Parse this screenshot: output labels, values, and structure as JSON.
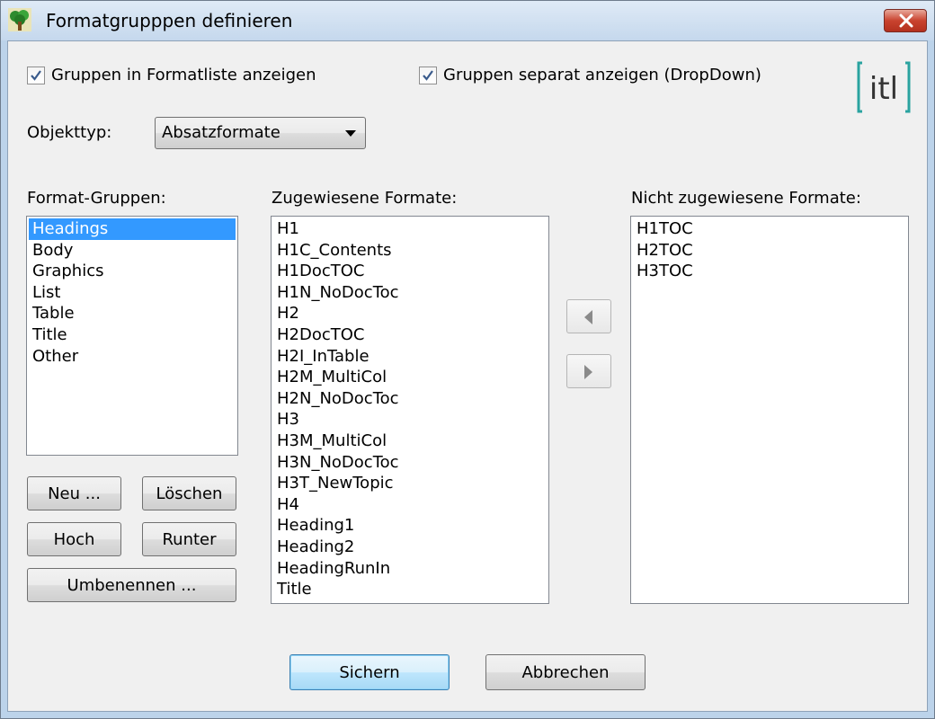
{
  "window": {
    "title": "Formatgrupppen definieren"
  },
  "options": {
    "show_groups_in_list": {
      "label": "Gruppen in Formatliste anzeigen",
      "checked": true
    },
    "show_groups_separately": {
      "label": "Gruppen separat anzeigen (DropDown)",
      "checked": true
    }
  },
  "logo": {
    "text": "itl",
    "color": "#2aa3a0"
  },
  "object_type": {
    "label": "Objekttyp:",
    "value": "Absatzformate"
  },
  "format_groups": {
    "label": "Format-Gruppen:",
    "items": [
      "Headings",
      "Body",
      "Graphics",
      "List",
      "Table",
      "Title",
      "Other"
    ],
    "selected": "Headings"
  },
  "assigned_formats": {
    "label": "Zugewiesene Formate:",
    "items": [
      "H1",
      "H1C_Contents",
      "H1DocTOC",
      "H1N_NoDocToc",
      "H2",
      "H2DocTOC",
      "H2I_InTable",
      "H2M_MultiCol",
      "H2N_NoDocToc",
      "H3",
      "H3M_MultiCol",
      "H3N_NoDocToc",
      "H3T_NewTopic",
      "H4",
      "Heading1",
      "Heading2",
      "HeadingRunIn",
      "Title"
    ]
  },
  "unassigned_formats": {
    "label": "Nicht zugewiesene Formate:",
    "items": [
      "H1TOC",
      "H2TOC",
      "H3TOC"
    ]
  },
  "group_buttons": {
    "new": "Neu ...",
    "delete": "Löschen",
    "up": "Hoch",
    "down": "Runter",
    "rename": "Umbenennen ..."
  },
  "footer": {
    "save": "Sichern",
    "cancel": "Abbrechen"
  },
  "colors": {
    "selection": "#3399ff",
    "titlebar": "#c5d8ed",
    "close": "#c9432f"
  }
}
